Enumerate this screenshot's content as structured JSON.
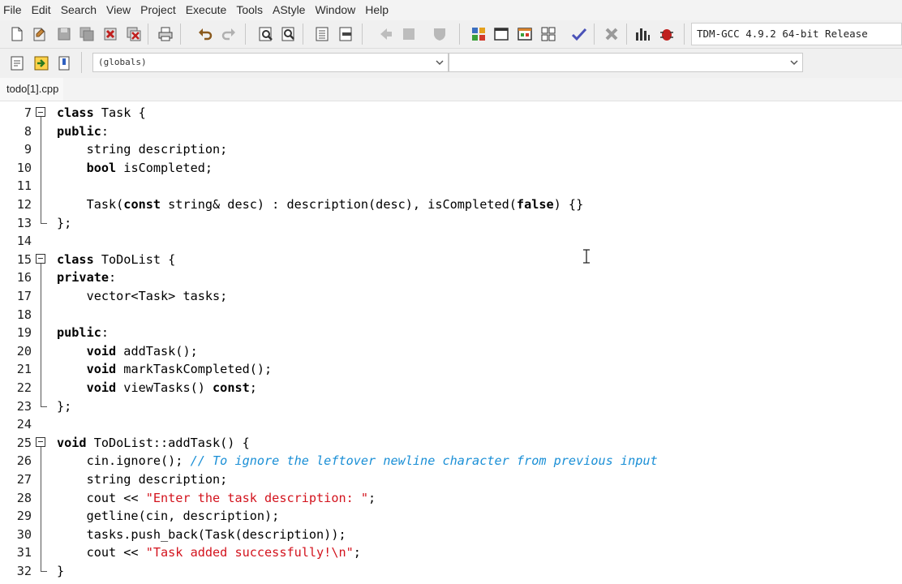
{
  "menubar": {
    "items": [
      "File",
      "Edit",
      "Search",
      "View",
      "Project",
      "Execute",
      "Tools",
      "AStyle",
      "Window",
      "Help"
    ]
  },
  "toolbar": {
    "compiler": "TDM-GCC 4.9.2 64-bit Release"
  },
  "toolbar2": {
    "class_combo": "(globals)",
    "member_combo": ""
  },
  "tabs": {
    "file": "todo[1].cpp"
  },
  "colors": {
    "keyword": "#000000",
    "string": "#d3131d",
    "comment": "#1a8fd6"
  },
  "editor": {
    "lines": [
      {
        "num": "7",
        "fold": "start",
        "tokens": [
          {
            "t": "kw",
            "v": "class"
          },
          {
            "t": "pl",
            "v": " Task {"
          }
        ]
      },
      {
        "num": "8",
        "tokens": [
          {
            "t": "kw",
            "v": "public"
          },
          {
            "t": "pl",
            "v": ":"
          }
        ]
      },
      {
        "num": "9",
        "tokens": [
          {
            "t": "pl",
            "v": "    string description;"
          }
        ]
      },
      {
        "num": "10",
        "tokens": [
          {
            "t": "pl",
            "v": "    "
          },
          {
            "t": "kw",
            "v": "bool"
          },
          {
            "t": "pl",
            "v": " isCompleted;"
          }
        ]
      },
      {
        "num": "11",
        "tokens": []
      },
      {
        "num": "12",
        "tokens": [
          {
            "t": "pl",
            "v": "    Task("
          },
          {
            "t": "kw",
            "v": "const"
          },
          {
            "t": "pl",
            "v": " string& desc) : description(desc), isCompleted("
          },
          {
            "t": "kw",
            "v": "false"
          },
          {
            "t": "pl",
            "v": ") {}"
          }
        ]
      },
      {
        "num": "13",
        "fold": "end",
        "tokens": [
          {
            "t": "pl",
            "v": "};"
          }
        ]
      },
      {
        "num": "14",
        "tokens": []
      },
      {
        "num": "15",
        "fold": "start",
        "tokens": [
          {
            "t": "kw",
            "v": "class"
          },
          {
            "t": "pl",
            "v": " ToDoList {"
          }
        ]
      },
      {
        "num": "16",
        "tokens": [
          {
            "t": "kw",
            "v": "private"
          },
          {
            "t": "pl",
            "v": ":"
          }
        ]
      },
      {
        "num": "17",
        "tokens": [
          {
            "t": "pl",
            "v": "    vector<Task> tasks;"
          }
        ]
      },
      {
        "num": "18",
        "tokens": []
      },
      {
        "num": "19",
        "tokens": [
          {
            "t": "kw",
            "v": "public"
          },
          {
            "t": "pl",
            "v": ":"
          }
        ]
      },
      {
        "num": "20",
        "tokens": [
          {
            "t": "pl",
            "v": "    "
          },
          {
            "t": "kw",
            "v": "void"
          },
          {
            "t": "pl",
            "v": " addTask();"
          }
        ]
      },
      {
        "num": "21",
        "tokens": [
          {
            "t": "pl",
            "v": "    "
          },
          {
            "t": "kw",
            "v": "void"
          },
          {
            "t": "pl",
            "v": " markTaskCompleted();"
          }
        ]
      },
      {
        "num": "22",
        "tokens": [
          {
            "t": "pl",
            "v": "    "
          },
          {
            "t": "kw",
            "v": "void"
          },
          {
            "t": "pl",
            "v": " viewTasks() "
          },
          {
            "t": "kw",
            "v": "const"
          },
          {
            "t": "pl",
            "v": ";"
          }
        ]
      },
      {
        "num": "23",
        "fold": "end",
        "tokens": [
          {
            "t": "pl",
            "v": "};"
          }
        ]
      },
      {
        "num": "24",
        "tokens": []
      },
      {
        "num": "25",
        "fold": "start",
        "tokens": [
          {
            "t": "kw",
            "v": "void"
          },
          {
            "t": "pl",
            "v": " ToDoList::addTask() {"
          }
        ]
      },
      {
        "num": "26",
        "tokens": [
          {
            "t": "pl",
            "v": "    cin.ignore(); "
          },
          {
            "t": "cm",
            "v": "// To ignore the leftover newline character from previous input"
          }
        ]
      },
      {
        "num": "27",
        "tokens": [
          {
            "t": "pl",
            "v": "    string description;"
          }
        ]
      },
      {
        "num": "28",
        "tokens": [
          {
            "t": "pl",
            "v": "    cout << "
          },
          {
            "t": "str",
            "v": "\"Enter the task description: \""
          },
          {
            "t": "pl",
            "v": ";"
          }
        ]
      },
      {
        "num": "29",
        "tokens": [
          {
            "t": "pl",
            "v": "    getline(cin, description);"
          }
        ]
      },
      {
        "num": "30",
        "tokens": [
          {
            "t": "pl",
            "v": "    tasks.push_back(Task(description));"
          }
        ]
      },
      {
        "num": "31",
        "tokens": [
          {
            "t": "pl",
            "v": "    cout << "
          },
          {
            "t": "str",
            "v": "\"Task added successfully!\\n\""
          },
          {
            "t": "pl",
            "v": ";"
          }
        ]
      },
      {
        "num": "32",
        "fold": "end",
        "tokens": [
          {
            "t": "pl",
            "v": "}"
          }
        ]
      }
    ]
  }
}
